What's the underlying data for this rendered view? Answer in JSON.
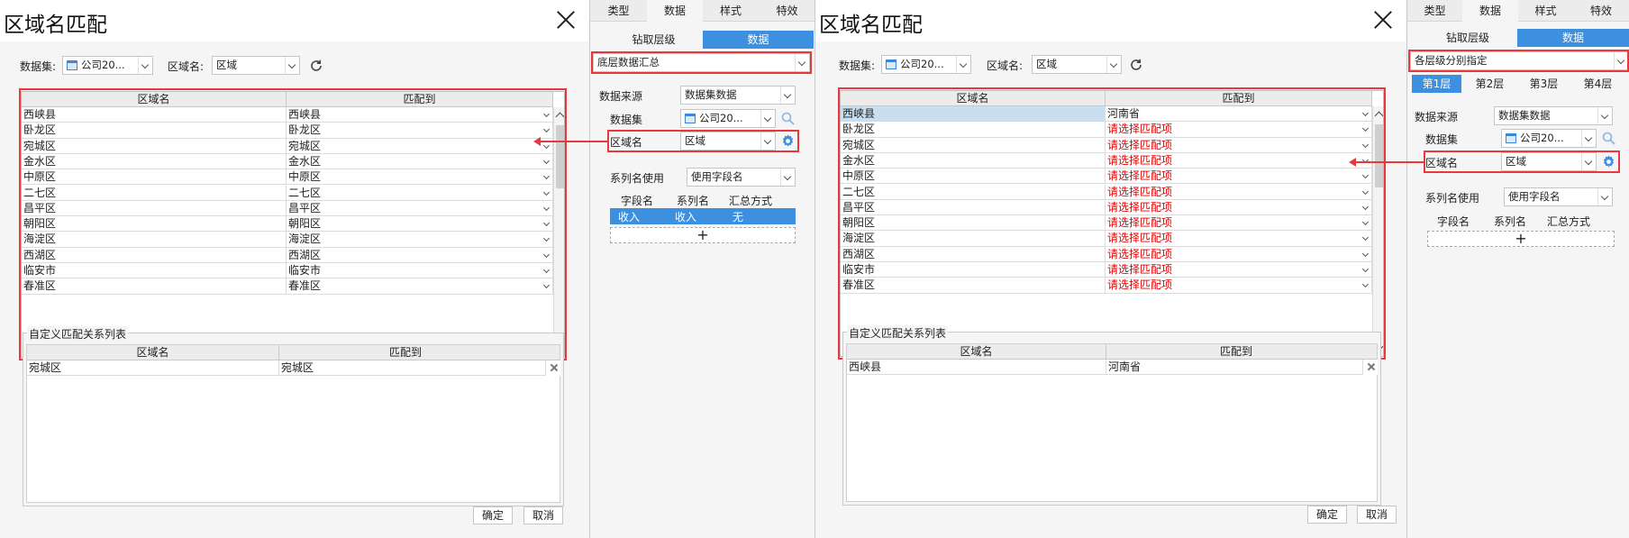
{
  "left_dialog": {
    "title": "区域名匹配",
    "dataset_label": "数据集:",
    "dataset_value": "公司20...",
    "region_label": "区域名:",
    "region_value": "区域",
    "table": {
      "headers": [
        "区域名",
        "匹配到"
      ],
      "rows": [
        {
          "name": "西峡县",
          "match": "西峡县"
        },
        {
          "name": "卧龙区",
          "match": "卧龙区"
        },
        {
          "name": "宛城区",
          "match": "宛城区"
        },
        {
          "name": "金水区",
          "match": "金水区"
        },
        {
          "name": "中原区",
          "match": "中原区"
        },
        {
          "name": "二七区",
          "match": "二七区"
        },
        {
          "name": "昌平区",
          "match": "昌平区"
        },
        {
          "name": "朝阳区",
          "match": "朝阳区"
        },
        {
          "name": "海淀区",
          "match": "海淀区"
        },
        {
          "name": "西湖区",
          "match": "西湖区"
        },
        {
          "name": "临安市",
          "match": "临安市"
        },
        {
          "name": "春准区",
          "match": "春准区"
        }
      ]
    },
    "custom": {
      "legend": "自定义匹配关系列表",
      "headers": [
        "区域名",
        "匹配到"
      ],
      "rows": [
        {
          "name": "宛城区",
          "match": "宛城区"
        }
      ]
    },
    "ok": "确定",
    "cancel": "取消"
  },
  "left_side": {
    "tabs": [
      "类型",
      "数据",
      "样式",
      "特效"
    ],
    "active_tab": 1,
    "seg": [
      "钻取层级",
      "数据"
    ],
    "mode": "底层数据汇总",
    "source_label": "数据来源",
    "source_value": "数据集数据",
    "dataset_label": "数据集",
    "dataset_value": "公司20...",
    "region_label": "区域名",
    "region_value": "区域",
    "series_label": "系列名使用",
    "series_value": "使用字段名",
    "field_headers": [
      "字段名",
      "系列名",
      "汇总方式"
    ],
    "field_row": [
      "收入",
      "收入",
      "无"
    ]
  },
  "right_dialog": {
    "title": "区域名匹配",
    "dataset_label": "数据集:",
    "dataset_value": "公司20...",
    "region_label": "区域名:",
    "region_value": "区域",
    "table": {
      "headers": [
        "区域名",
        "匹配到"
      ],
      "rows": [
        {
          "name": "西峡县",
          "match": "河南省"
        },
        {
          "name": "卧龙区",
          "match": "请选择匹配项"
        },
        {
          "name": "宛城区",
          "match": "请选择匹配项"
        },
        {
          "name": "金水区",
          "match": "请选择匹配项"
        },
        {
          "name": "中原区",
          "match": "请选择匹配项"
        },
        {
          "name": "二七区",
          "match": "请选择匹配项"
        },
        {
          "name": "昌平区",
          "match": "请选择匹配项"
        },
        {
          "name": "朝阳区",
          "match": "请选择匹配项"
        },
        {
          "name": "海淀区",
          "match": "请选择匹配项"
        },
        {
          "name": "西湖区",
          "match": "请选择匹配项"
        },
        {
          "name": "临安市",
          "match": "请选择匹配项"
        },
        {
          "name": "春准区",
          "match": "请选择匹配项"
        }
      ]
    },
    "custom": {
      "legend": "自定义匹配关系列表",
      "headers": [
        "区域名",
        "匹配到"
      ],
      "rows": [
        {
          "name": "西峡县",
          "match": "河南省"
        }
      ]
    },
    "ok": "确定",
    "cancel": "取消"
  },
  "right_side": {
    "tabs": [
      "类型",
      "数据",
      "样式",
      "特效"
    ],
    "active_tab": 1,
    "seg": [
      "钻取层级",
      "数据"
    ],
    "mode": "各层级分别指定",
    "layers": [
      "第1层",
      "第2层",
      "第3层",
      "第4层"
    ],
    "source_label": "数据来源",
    "source_value": "数据集数据",
    "dataset_label": "数据集",
    "dataset_value": "公司20...",
    "region_label": "区域名",
    "region_value": "区域",
    "series_label": "系列名使用",
    "series_value": "使用字段名",
    "field_headers": [
      "字段名",
      "系列名",
      "汇总方式"
    ]
  },
  "colors": {
    "accent": "#3d8fe0",
    "highlight": "#e8383d",
    "warning_text": "#e60000"
  }
}
